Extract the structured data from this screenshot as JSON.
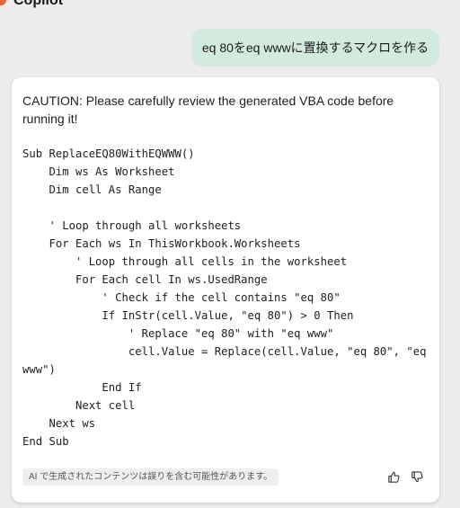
{
  "header": {
    "app_title": "Copilot",
    "chevron_glyph": "⌃",
    "logo_color": "#e8693a"
  },
  "user_message": {
    "text": "eq 80をeq wwwに置換するマクロを作る"
  },
  "assistant": {
    "caution": "CAUTION: Please carefully review the generated VBA code before running it!",
    "code_lines": [
      "Sub ReplaceEQ80WithEQWWW()",
      "    Dim ws As Worksheet",
      "    Dim cell As Range",
      "",
      "    ' Loop through all worksheets",
      "    For Each ws In ThisWorkbook.Worksheets",
      "        ' Loop through all cells in the worksheet",
      "        For Each cell In ws.UsedRange",
      "            ' Check if the cell contains \"eq 80\"",
      "            If InStr(cell.Value, \"eq 80\") > 0 Then",
      "                ' Replace \"eq 80\" with \"eq www\"",
      "                cell.Value = Replace(cell.Value, \"eq 80\", \"eq",
      "www\")",
      "            End If",
      "        Next cell",
      "    Next ws",
      "End Sub"
    ],
    "disclaimer": "AI で生成されたコンテンツは誤りを含む可能性があります。",
    "feedback_icons": [
      "thumbs-up-icon",
      "thumbs-down-icon"
    ]
  },
  "colors": {
    "background": "#ececec",
    "user_bubble": "#d3ebdf",
    "card": "#ffffff"
  }
}
